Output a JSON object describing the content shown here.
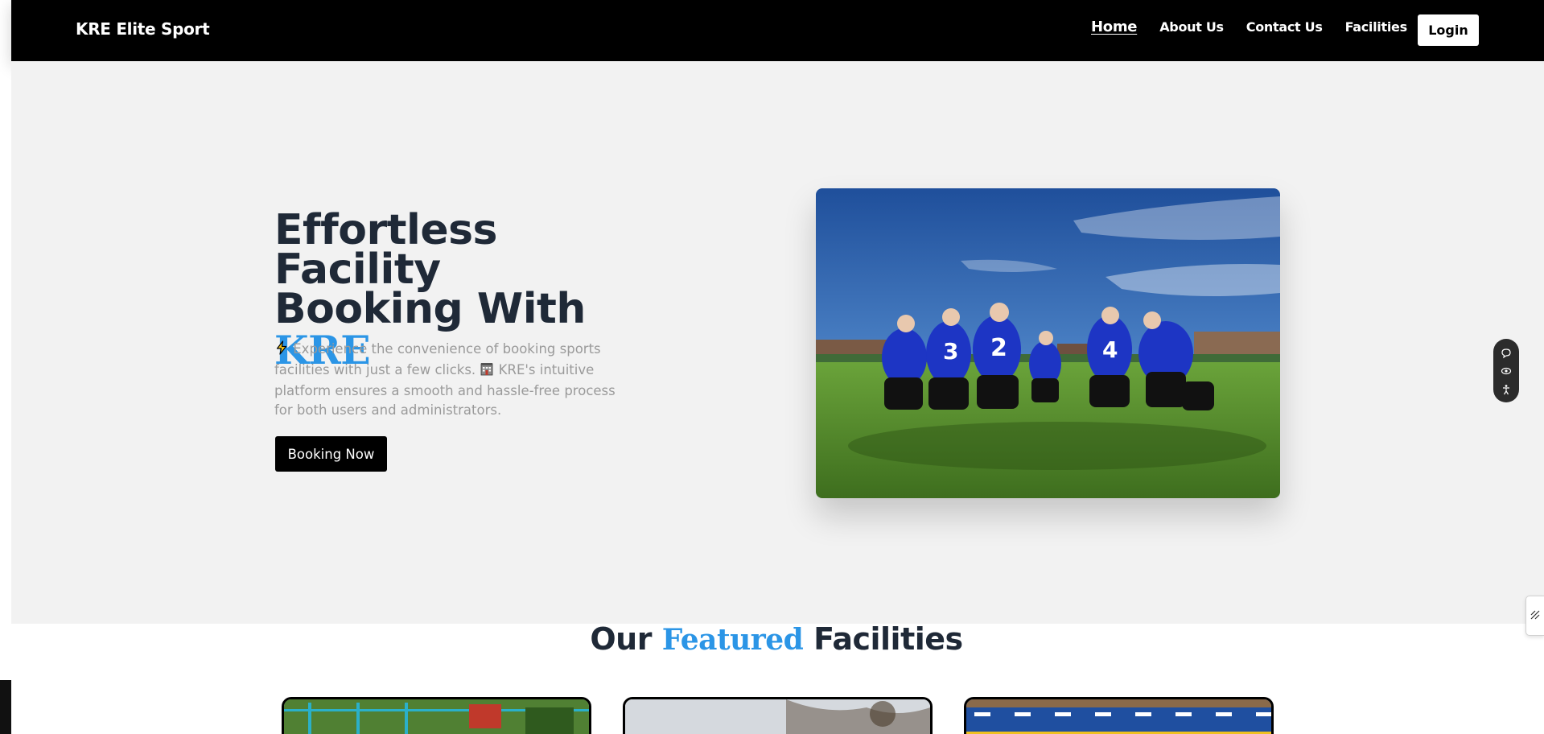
{
  "navbar": {
    "brand": "KRE Elite Sport",
    "links": [
      {
        "label": "Home",
        "active": true
      },
      {
        "label": "About Us"
      },
      {
        "label": "Contact Us"
      },
      {
        "label": "Facilities"
      }
    ],
    "login_label": "Login"
  },
  "hero": {
    "title_line1": "Effortless Facility",
    "title_line2": "Booking With",
    "title_accent": "KRE",
    "desc_part1": "Experience the convenience of booking sports facilities with just a few clicks.",
    "desc_part2": "KRE's intuitive platform ensures a smooth and hassle-free process for both users and administrators.",
    "cta_label": "Booking Now",
    "image_icon": "football-team-photo"
  },
  "featured": {
    "title_before": "Our",
    "title_accent": "Featured",
    "title_after": "Facilities"
  },
  "colors": {
    "accent": "#2b95e6",
    "nav_bg": "#000000",
    "hero_bg": "#f2f2f2",
    "heading": "#1f2937"
  }
}
